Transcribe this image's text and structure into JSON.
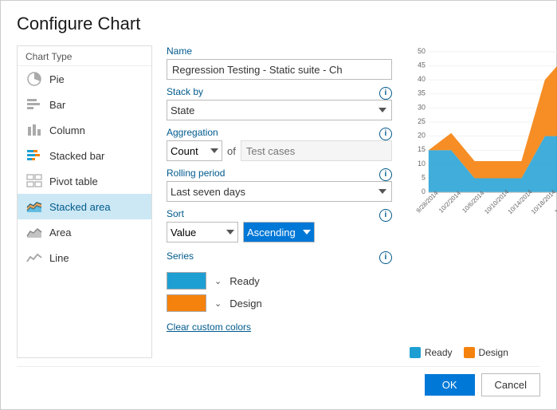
{
  "dialog": {
    "title": "Configure Chart"
  },
  "chart_types": [
    {
      "id": "pie",
      "label": "Pie",
      "icon": "pie"
    },
    {
      "id": "bar",
      "label": "Bar",
      "icon": "bar"
    },
    {
      "id": "column",
      "label": "Column",
      "icon": "column"
    },
    {
      "id": "stacked-bar",
      "label": "Stacked bar",
      "icon": "stacked-bar"
    },
    {
      "id": "pivot-table",
      "label": "Pivot table",
      "icon": "pivot"
    },
    {
      "id": "stacked-area",
      "label": "Stacked area",
      "icon": "stacked-area",
      "active": true
    },
    {
      "id": "area",
      "label": "Area",
      "icon": "area"
    },
    {
      "id": "line",
      "label": "Line",
      "icon": "line"
    }
  ],
  "form": {
    "name_label": "Name",
    "name_value": "Regression Testing - Static suite - Ch",
    "stack_by_label": "Stack by",
    "stack_by_value": "State",
    "aggregation_label": "Aggregation",
    "aggregation_value": "Count",
    "aggregation_of": "of",
    "aggregation_field": "Test cases",
    "rolling_period_label": "Rolling period",
    "rolling_period_value": "Last seven days",
    "sort_label": "Sort",
    "sort_value": "Value",
    "sort_order_value": "Ascending",
    "series_label": "Series",
    "series": [
      {
        "name": "Ready",
        "color": "#1e9fd4"
      },
      {
        "name": "Design",
        "color": "#f5820d"
      }
    ],
    "clear_colors_label": "Clear custom colors"
  },
  "chart": {
    "legend": [
      {
        "name": "Ready",
        "color": "#1e9fd4"
      },
      {
        "name": "Design",
        "color": "#f5820d"
      }
    ]
  },
  "footer": {
    "ok_label": "OK",
    "cancel_label": "Cancel"
  }
}
